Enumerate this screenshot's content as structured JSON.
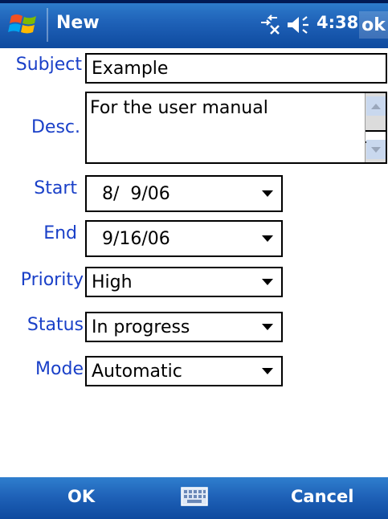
{
  "titlebar": {
    "title": "New",
    "time": "4:38",
    "ok_label": "ok"
  },
  "form": {
    "subject": {
      "label": "Subject",
      "value": "Example"
    },
    "desc": {
      "label": "Desc.",
      "value": "For the user manual"
    },
    "start": {
      "label": "Start",
      "value": " 8/  9/06"
    },
    "end": {
      "label": "End",
      "value": " 9/16/06"
    },
    "priority": {
      "label": "Priority",
      "value": "High"
    },
    "status": {
      "label": "Status",
      "value": "In progress"
    },
    "mode": {
      "label": "Mode",
      "value": "Automatic"
    }
  },
  "softkeys": {
    "left": "OK",
    "right": "Cancel"
  },
  "icons": {
    "start": "windows-flag-icon",
    "connectivity": "connectivity-icon",
    "volume": "speaker-icon",
    "keyboard": "keyboard-icon"
  }
}
